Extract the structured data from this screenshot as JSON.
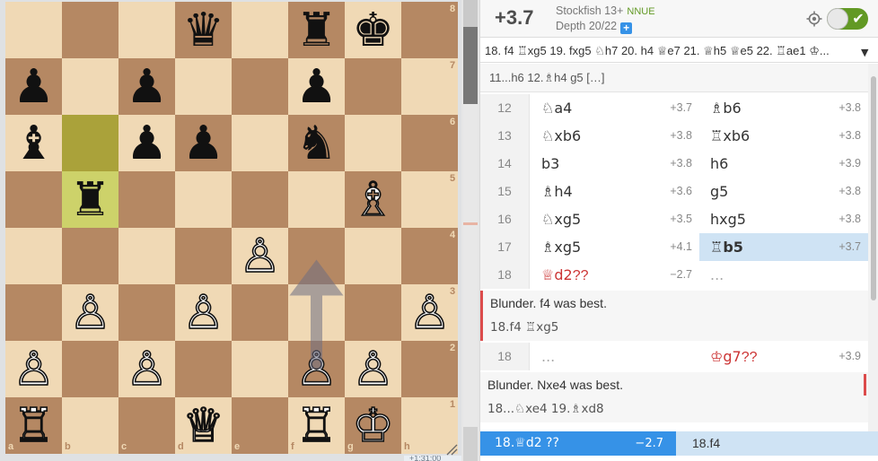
{
  "board": {
    "files": [
      "a",
      "b",
      "c",
      "d",
      "e",
      "f",
      "g",
      "h"
    ],
    "ranks": [
      "8",
      "7",
      "6",
      "5",
      "4",
      "3",
      "2",
      "1"
    ],
    "highlight_squares": [
      "b6",
      "b5"
    ],
    "arrow": {
      "from": "f2",
      "to": "f4"
    },
    "pieces": [
      {
        "sq": "d8",
        "glyph": "♛",
        "color": "black",
        "name": "black-queen"
      },
      {
        "sq": "f8",
        "glyph": "♜",
        "color": "black",
        "name": "black-rook"
      },
      {
        "sq": "g8",
        "glyph": "♚",
        "color": "black",
        "name": "black-king"
      },
      {
        "sq": "a7",
        "glyph": "♟",
        "color": "black",
        "name": "black-pawn"
      },
      {
        "sq": "c7",
        "glyph": "♟",
        "color": "black",
        "name": "black-pawn"
      },
      {
        "sq": "f7",
        "glyph": "♟",
        "color": "black",
        "name": "black-pawn"
      },
      {
        "sq": "a6",
        "glyph": "♝",
        "color": "black",
        "name": "black-bishop"
      },
      {
        "sq": "c6",
        "glyph": "♟",
        "color": "black",
        "name": "black-pawn"
      },
      {
        "sq": "d6",
        "glyph": "♟",
        "color": "black",
        "name": "black-pawn"
      },
      {
        "sq": "f6",
        "glyph": "♞",
        "color": "black",
        "name": "black-knight"
      },
      {
        "sq": "b5",
        "glyph": "♜",
        "color": "black",
        "name": "black-rook"
      },
      {
        "sq": "g5",
        "glyph": "♗",
        "color": "white",
        "name": "white-bishop"
      },
      {
        "sq": "e4",
        "glyph": "♙",
        "color": "white",
        "name": "white-pawn"
      },
      {
        "sq": "b3",
        "glyph": "♙",
        "color": "white",
        "name": "white-pawn"
      },
      {
        "sq": "d3",
        "glyph": "♙",
        "color": "white",
        "name": "white-pawn"
      },
      {
        "sq": "h3",
        "glyph": "♙",
        "color": "white",
        "name": "white-pawn"
      },
      {
        "sq": "a2",
        "glyph": "♙",
        "color": "white",
        "name": "white-pawn"
      },
      {
        "sq": "c2",
        "glyph": "♙",
        "color": "white",
        "name": "white-pawn"
      },
      {
        "sq": "f2",
        "glyph": "♙",
        "color": "white",
        "name": "white-pawn"
      },
      {
        "sq": "g2",
        "glyph": "♙",
        "color": "white",
        "name": "white-pawn"
      },
      {
        "sq": "a1",
        "glyph": "♖",
        "color": "white",
        "name": "white-rook"
      },
      {
        "sq": "d1",
        "glyph": "♕",
        "color": "white",
        "name": "white-queen"
      },
      {
        "sq": "f1",
        "glyph": "♖",
        "color": "white",
        "name": "white-rook"
      },
      {
        "sq": "g1",
        "glyph": "♔",
        "color": "white",
        "name": "white-king"
      }
    ],
    "bottom_tag": "+1:31:00"
  },
  "ceval": {
    "score": "+3.7",
    "engine": "Stockfish 13+",
    "nnue": "NNUE",
    "depth": "Depth 20/22",
    "depth_plus": "+",
    "toggle_check": "✔"
  },
  "pv": {
    "line": "18. f4 ♖xg5 19. fxg5 ♘h7 20. h4 ♕e7 21. ♕h5 ♕e5 22. ♖ae1 ♔...",
    "dropdown": "▼"
  },
  "moves": {
    "variation_top": "11...h6 12.♗h4 g5 […]",
    "rows": [
      {
        "num": "12",
        "w": "♘a4",
        "w_eval": "+3.7",
        "b": "♗b6",
        "b_eval": "+3.8"
      },
      {
        "num": "13",
        "w": "♘xb6",
        "w_eval": "+3.8",
        "b": "♖xb6",
        "b_eval": "+3.8"
      },
      {
        "num": "14",
        "w": "b3",
        "w_eval": "+3.8",
        "b": "h6",
        "b_eval": "+3.9"
      },
      {
        "num": "15",
        "w": "♗h4",
        "w_eval": "+3.6",
        "b": "g5",
        "b_eval": "+3.8"
      },
      {
        "num": "16",
        "w": "♘xg5",
        "w_eval": "+3.5",
        "b": "hxg5",
        "b_eval": "+3.8"
      },
      {
        "num": "17",
        "w": "♗xg5",
        "w_eval": "+4.1",
        "b": "♖b5",
        "b_eval": "+3.7"
      },
      {
        "num": "18",
        "w": "♕d2",
        "w_ann": "??",
        "w_eval": "−2.7",
        "b": "...",
        "b_eval": ""
      }
    ],
    "comment1": {
      "text": "Blunder. f4 was best.",
      "line": "18.f4 ♖xg5"
    },
    "row18b": {
      "num": "18",
      "w": "...",
      "b": "♔g7",
      "b_ann": "??",
      "b_eval": "+3.9"
    },
    "comment2": {
      "text": "Blunder. Nxe4 was best.",
      "line": "18...♘xe4 19.♗xd8"
    }
  },
  "bottom_bar": {
    "left_move": "18.♕d2 ??",
    "left_eval": "−2.7",
    "right_move": "18.f4"
  },
  "colors": {
    "light_square": "#f0d9b5",
    "dark_square": "#b58863",
    "highlight_dark": "#aaa23a",
    "highlight_light": "#cdd26a",
    "accent_blue": "#3692e7",
    "active_move_bg": "#cfe3f4",
    "blunder_red": "#cc3333",
    "nnue_green": "#629924"
  }
}
